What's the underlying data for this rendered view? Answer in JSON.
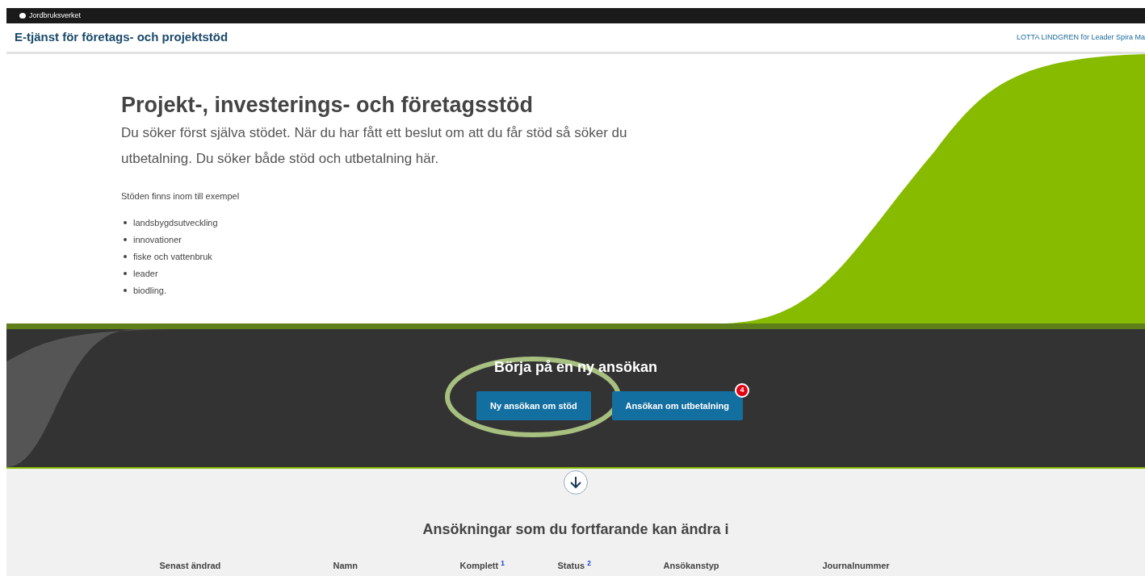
{
  "topbar": {
    "brand": "Jordbruksverket"
  },
  "header": {
    "title": "E-tjänst för företags- och projektstöd",
    "user": "LOTTA LINDGREN för Leader Spira Ma"
  },
  "hero": {
    "title": "Projekt-, investerings- och företagsstöd",
    "lead": "Du söker först själva stödet. När du har fått ett beslut om att du får stöd så söker du utbetalning. Du söker både stöd och utbetalning här.",
    "intro": "Stöden finns inom till exempel",
    "items": [
      "landsbygdsutveckling",
      "innovationer",
      "fiske och vattenbruk",
      "leader",
      "biodling."
    ]
  },
  "start": {
    "title": "Börja på en ny ansökan",
    "buttons": [
      {
        "label": "Ny ansökan om stöd",
        "highlighted": true
      },
      {
        "label": "Ansökan om utbetalning",
        "badge": "4"
      }
    ]
  },
  "applications": {
    "title": "Ansökningar som du fortfarande kan ändra i",
    "columns": [
      "Senast ändrad",
      "Namn",
      "Komplett $^{1}$",
      "Status $^{2}$",
      "Ansökanstyp",
      "Journalnummer"
    ]
  }
}
